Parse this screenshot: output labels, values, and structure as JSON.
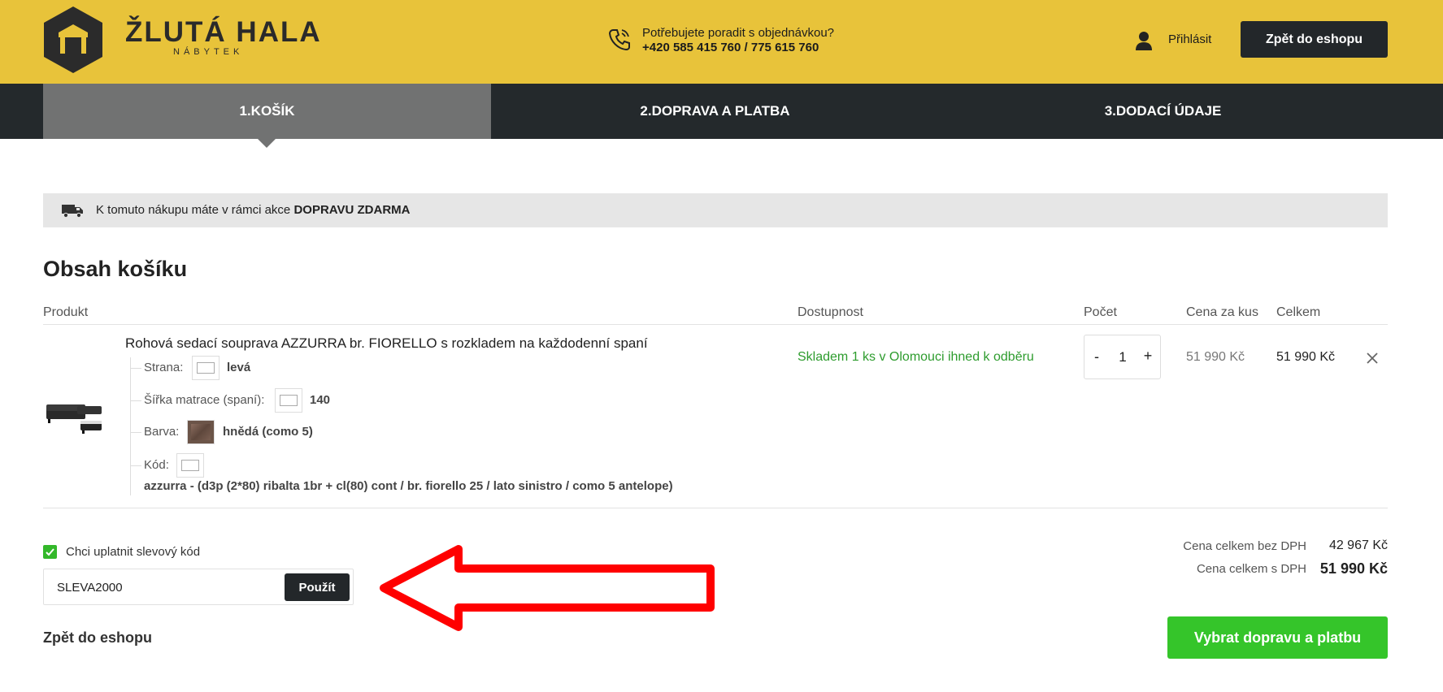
{
  "header": {
    "brand_name": "ŽLUTÁ HALA",
    "brand_sub": "NÁBYTEK",
    "help_text": "Potřebujete poradit s objednávkou?",
    "help_phone": "+420 585 415 760 / 775 615 760",
    "login_label": "Přihlásit",
    "back_button": "Zpět do eshopu"
  },
  "steps": [
    {
      "label": "1.KOŠÍK",
      "active": true
    },
    {
      "label": "2.DOPRAVA A PLATBA",
      "active": false
    },
    {
      "label": "3.DODACÍ ÚDAJE",
      "active": false
    }
  ],
  "shipping_notice": {
    "text": "K tomuto nákupu máte v rámci akce ",
    "highlight": "DOPRAVU ZDARMA"
  },
  "cart": {
    "title": "Obsah košíku",
    "columns": {
      "product": "Produkt",
      "availability": "Dostupnost",
      "quantity": "Počet",
      "unit_price": "Cena za kus",
      "total": "Celkem"
    },
    "items": [
      {
        "name": "Rohová sedací souprava AZZURRA br. FIORELLO s rozkladem na každodenní spaní",
        "attributes": [
          {
            "label": "Strana:",
            "value": "levá"
          },
          {
            "label": "Šířka matrace (spaní):",
            "value": "140"
          },
          {
            "label": "Barva:",
            "value": "hnědá (como 5)"
          },
          {
            "label": "Kód:",
            "value": "azzurra - (d3p (2*80) ribalta 1br + cl(80) cont / br. fiorello 25 / lato sinistro / como 5 antelope)"
          }
        ],
        "availability": "Skladem 1 ks v Olomouci ihned k odběru",
        "qty_minus": "-",
        "quantity": "1",
        "qty_plus": "+",
        "unit_price": "51 990 Kč",
        "total": "51 990 Kč"
      }
    ]
  },
  "discount": {
    "checkbox_label": "Chci uplatnit slevový kód",
    "checked": true,
    "code_value": "SLEVA2000",
    "apply_label": "Použít"
  },
  "totals": {
    "without_vat_label": "Cena celkem bez DPH",
    "without_vat_value": "42 967 Kč",
    "with_vat_label": "Cena celkem s DPH",
    "with_vat_value": "51 990 Kč"
  },
  "footer": {
    "back_link": "Zpět do eshopu",
    "next_button": "Vybrat dopravu a platbu"
  },
  "colors": {
    "header_bg": "#e8c33a",
    "dark": "#23272a",
    "active_step": "#717272",
    "green": "#35c52a",
    "annotation_arrow": "#ff0000"
  }
}
